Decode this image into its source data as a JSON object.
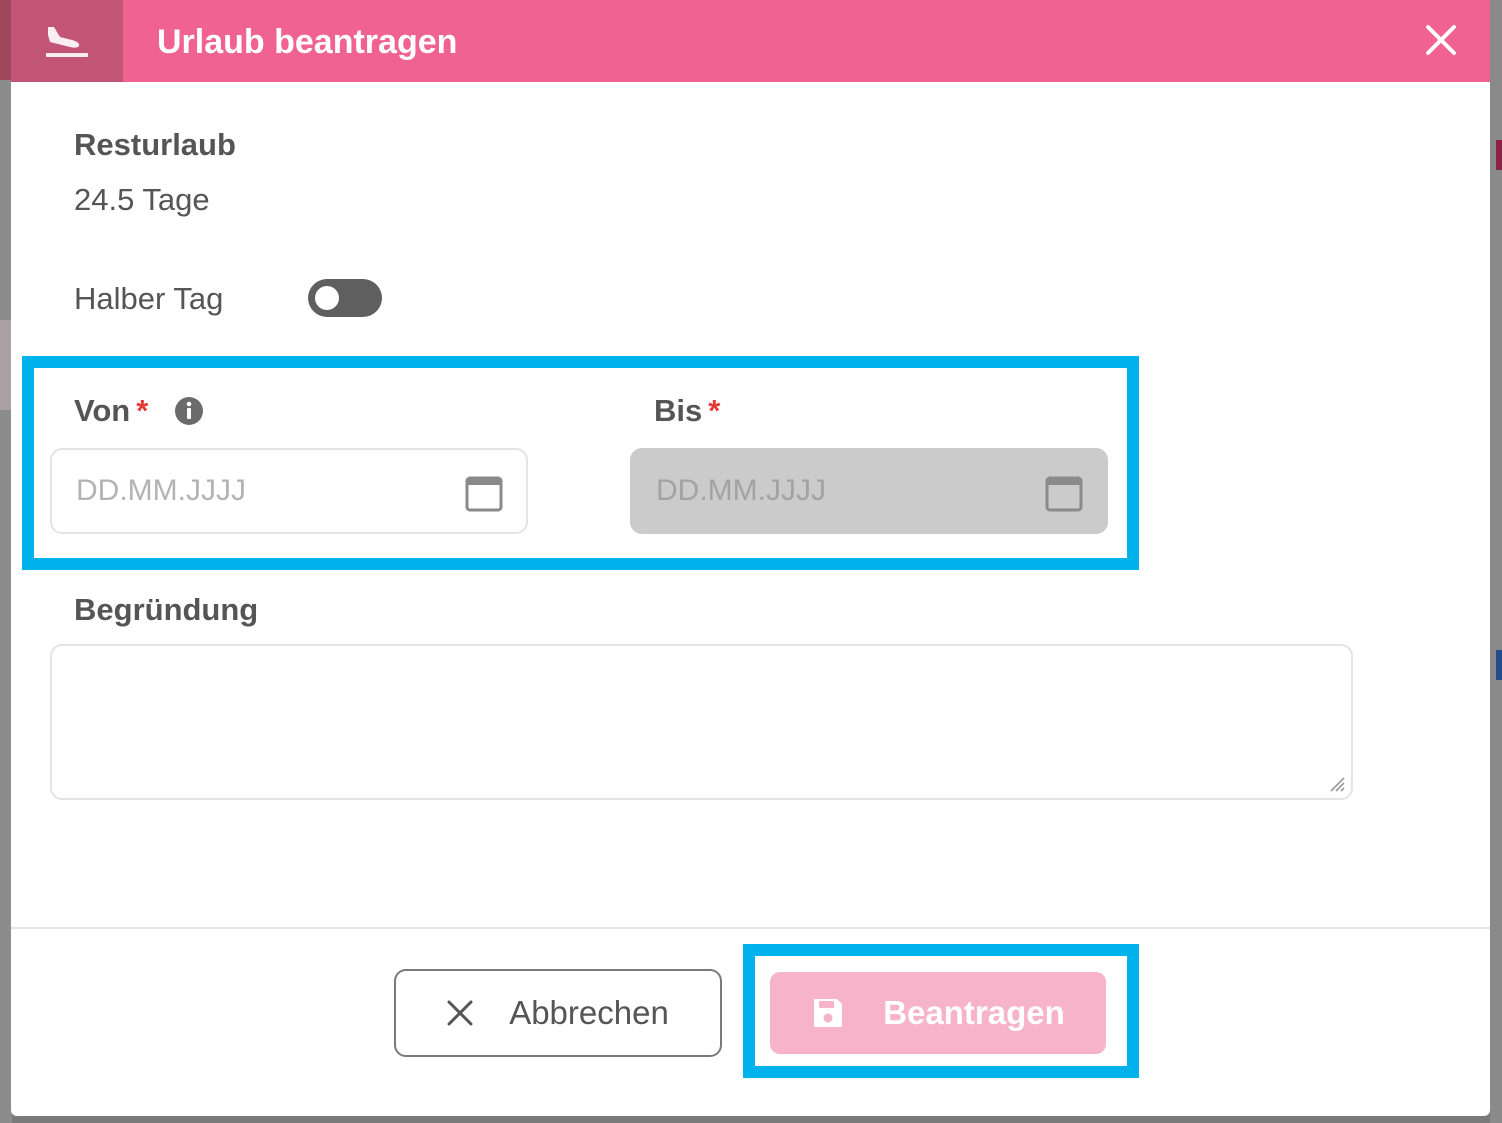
{
  "dialog": {
    "title": "Urlaub beantragen",
    "title_icon": "airplane-landing-icon",
    "close_icon": "close-icon"
  },
  "remaining": {
    "label": "Resturlaub",
    "value": "24.5 Tage"
  },
  "half_day": {
    "label": "Halber Tag",
    "enabled": false
  },
  "from": {
    "label": "Von",
    "required_mark": "*",
    "placeholder": "DD.MM.JJJJ",
    "value": "",
    "info_icon": "info-icon",
    "calendar_icon": "calendar-icon"
  },
  "to": {
    "label": "Bis",
    "required_mark": "*",
    "placeholder": "DD.MM.JJJJ",
    "value": "",
    "disabled": true,
    "calendar_icon": "calendar-icon"
  },
  "reason": {
    "label": "Begründung",
    "value": ""
  },
  "footer": {
    "cancel_label": "Abbrechen",
    "cancel_icon": "close-icon",
    "submit_label": "Beantragen",
    "submit_icon": "save-icon"
  },
  "colors": {
    "header": "#f06292",
    "header_icon_bg": "#c25478",
    "submit_disabled": "#f6b3c9",
    "required": "#e53935",
    "highlight": "#00b2ec"
  }
}
